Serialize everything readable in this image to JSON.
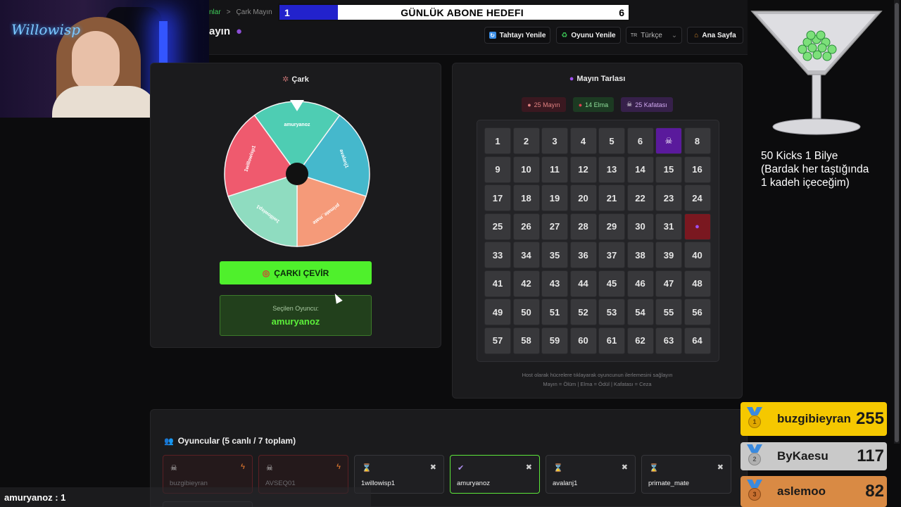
{
  "breadcrumb": {
    "prev": "nlar",
    "separator": ">",
    "current": "Çark Mayın"
  },
  "page_title": "ayın",
  "goal": {
    "current": "1",
    "title": "GÜNLÜK ABONE HEDEFI",
    "target": "6",
    "progress": 0.1667,
    "fill_color": "#2222cc"
  },
  "header_buttons": {
    "refresh_board": "Tahtayı Yenile",
    "refresh_game": "Oyunu Yenile",
    "language": "Türkçe",
    "language_flag": "TR",
    "home": "Ana Sayfa"
  },
  "webcam": {
    "logo": "Willowisp"
  },
  "wheel": {
    "title": "Çark",
    "segments": [
      {
        "name": "amuryanoz",
        "color": "#4ecdb3"
      },
      {
        "name": "avalanj1",
        "color": "#45b8cc"
      },
      {
        "name": "primate_mate",
        "color": "#f59a79"
      },
      {
        "name": "1willowisp1",
        "color": "#8fdcc0"
      },
      {
        "name": "1willowisp1",
        "color": "#ef5a6e"
      }
    ],
    "spin_label": "ÇARKI ÇEVİR",
    "selected_label": "Seçilen Oyuncu:",
    "selected_name": "amuryanoz"
  },
  "minefield": {
    "title": "Mayın Tarlası",
    "badges": {
      "mines": "25 Mayın",
      "apples": "14 Elma",
      "skulls": "25 Kafatası"
    },
    "revealed": {
      "7": "skull",
      "32": "mine"
    },
    "help_line1": "Host olarak hücrelere tıklayarak oyuncunun ilerlemesini sağlayın",
    "help_line2": "Mayın = Ölüm | Elma = Ödül | Kafatası = Ceza"
  },
  "players": {
    "title": "Oyuncular (5 canlı / 7 toplam)",
    "list": [
      {
        "name": "buzgibieyran",
        "state": "dead"
      },
      {
        "name": "AVSEQ01",
        "state": "dead"
      },
      {
        "name": "1willowisp1",
        "state": "waiting"
      },
      {
        "name": "amuryanoz",
        "state": "active"
      },
      {
        "name": "avalanj1",
        "state": "waiting"
      },
      {
        "name": "primate_mate",
        "state": "waiting"
      }
    ]
  },
  "kicks_text": {
    "line1": "50 Kicks 1 Bilye",
    "line2": "(Bardak her taştığında",
    "line3": "1 kadeh içeceğim)"
  },
  "leaderboard": [
    {
      "rank": "1",
      "name": "buzgibieyran",
      "score": "255"
    },
    {
      "rank": "2",
      "name": "ByKaesu",
      "score": "117"
    },
    {
      "rank": "3",
      "name": "aslemoo",
      "score": "82"
    }
  ],
  "chat_score": "amuryanoz : 1"
}
